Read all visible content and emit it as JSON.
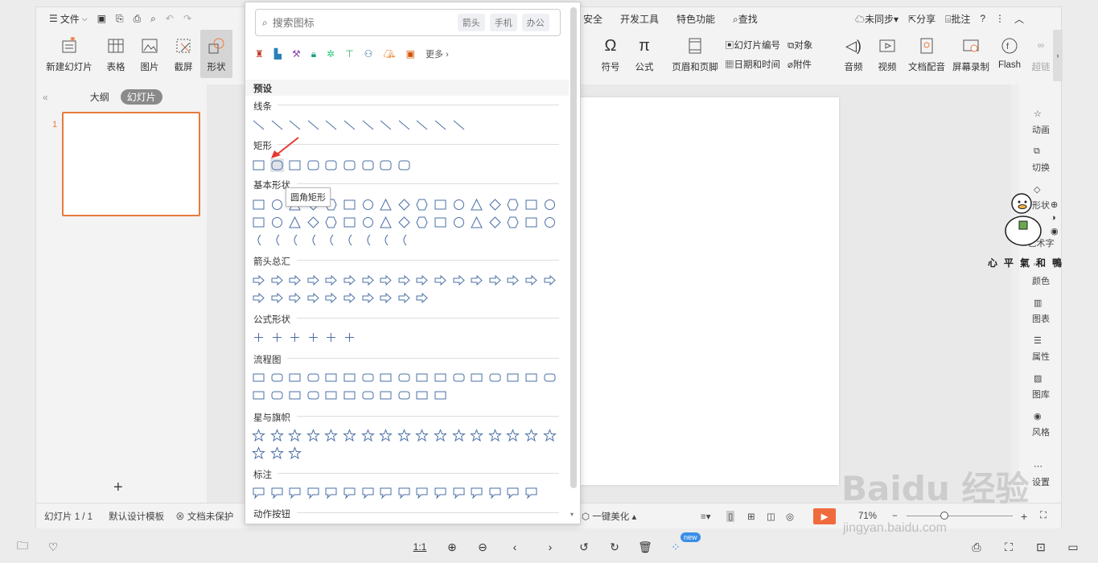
{
  "menubar": {
    "file": "文件",
    "right_tabs": [
      "安全",
      "开发工具",
      "特色功能"
    ],
    "search": "查找",
    "sync": "未同步",
    "share": "分享",
    "comment": "批注"
  },
  "ribbon": {
    "new_slide": "新建幻灯片",
    "table": "表格",
    "picture": "图片",
    "screenshot": "截屏",
    "shape": "形状",
    "symbol": "符号",
    "formula": "公式",
    "header_footer": "页眉和页脚",
    "slide_number": "幻灯片编号",
    "object": "对象",
    "date_time": "日期和时间",
    "attachment": "附件",
    "audio": "音频",
    "video": "视频",
    "doc_voice": "文档配音",
    "screen_record": "屏幕录制",
    "flash": "Flash",
    "hyperlink": "超链"
  },
  "left_panel": {
    "outline_tab": "大纲",
    "slides_tab": "幻灯片",
    "slide_number": "1",
    "collapse": "«"
  },
  "right_panel": [
    "动画",
    "切换",
    "形状",
    "艺术字",
    "颜色",
    "图表",
    "属性",
    "图库",
    "风格",
    "设置"
  ],
  "status": {
    "slide_info": "幻灯片 1 / 1",
    "template": "默认设计模板",
    "protect": "文档未保护",
    "beautify": "一键美化",
    "zoom": "71%"
  },
  "dropdown": {
    "search_placeholder": "搜索图标",
    "chips": [
      "箭头",
      "手机",
      "办公"
    ],
    "more": "更多",
    "preset": "预设",
    "sections": [
      "线条",
      "矩形",
      "基本形状",
      "箭头总汇",
      "公式形状",
      "流程图",
      "星与旗帜",
      "标注",
      "动作按钮"
    ],
    "tooltip": "圆角矩形"
  },
  "bottom": {
    "ratio": "1:1",
    "new_badge": "new"
  },
  "watermark": {
    "baidu": "Baidu 经验",
    "url": "jingyan.baidu.com",
    "duck_text": "心平氣和鴨"
  },
  "colors": {
    "accent": "#e87a3c",
    "play": "#f06b3c",
    "icon_blue": "#4a6fa5"
  }
}
